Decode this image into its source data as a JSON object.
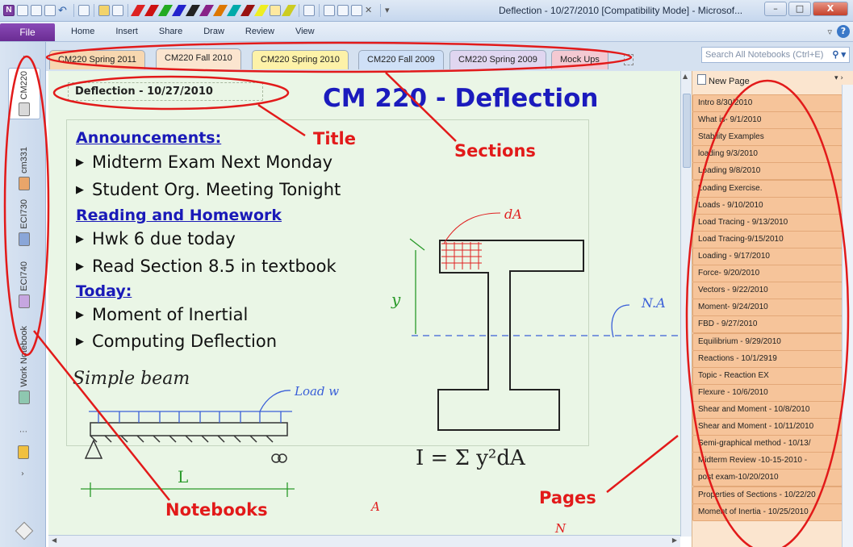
{
  "window": {
    "title": "Deflection - 10/27/2010 [Compatibility Mode] - Microsof...",
    "min": "–",
    "max": "□",
    "close": "X"
  },
  "menu": {
    "file": "File",
    "items": [
      "Home",
      "Insert",
      "Share",
      "Draw",
      "Review",
      "View"
    ]
  },
  "notebooks": [
    {
      "label": "CM220",
      "color": "#d9d9d9",
      "selected": true
    },
    {
      "label": "cm331",
      "color": "#e9a56a"
    },
    {
      "label": "ECI730",
      "color": "#8aa6d8"
    },
    {
      "label": "ECI740",
      "color": "#c6a6e0"
    },
    {
      "label": "Work Notebook",
      "color": "#8ec7b0"
    }
  ],
  "sections": [
    {
      "label": "CM220 Spring 2011",
      "color": "#f7d7b0"
    },
    {
      "label": "CM220 Fall 2010",
      "color": "#fbe5cf",
      "active": true
    },
    {
      "label": "CM220 Spring 2010",
      "color": "#fdf2a8"
    },
    {
      "label": "CM220 Fall 2009",
      "color": "#cfe0f7"
    },
    {
      "label": "CM220 Spring 2009",
      "color": "#e0d6f0"
    },
    {
      "label": "Mock Ups",
      "color": "#f4c9d2"
    }
  ],
  "search": {
    "placeholder": "Search All Notebooks (Ctrl+E)"
  },
  "page": {
    "title": "Deflection - 10/27/2010",
    "heading": "CM 220 - Deflection",
    "notes": [
      {
        "kind": "head",
        "text": "Announcements:"
      },
      {
        "kind": "item",
        "text": "Midterm Exam Next Monday"
      },
      {
        "kind": "item",
        "text": "Student Org. Meeting Tonight"
      },
      {
        "kind": "head",
        "text": "Reading and Homework"
      },
      {
        "kind": "item",
        "text": "Hwk 6 due today"
      },
      {
        "kind": "item",
        "text": "Read Section 8.5 in textbook"
      },
      {
        "kind": "head",
        "text": "Today:"
      },
      {
        "kind": "item",
        "text": "Moment of Inertial"
      },
      {
        "kind": "item",
        "text": "Computing Deflection"
      }
    ],
    "ink": {
      "beam_label": "Simple beam",
      "load_label": "Load w",
      "span_label": "L",
      "area_label": "dA",
      "y_label": "y",
      "na_label": "N.A",
      "formula": "I = Σ y²dA",
      "partial_a": "A",
      "partial_n": "N"
    }
  },
  "pages": {
    "new_page": "New Page",
    "items": [
      "Intro 8/30/2010",
      "What is- 9/1/2010",
      "Stability Examples",
      "loading 9/3/2010",
      "Loading 9/8/2010",
      "Loading Exercise.",
      "Loads - 9/10/2010",
      "Load Tracing - 9/13/2010",
      "Load Tracing-9/15/2010",
      "Loading - 9/17/2010",
      "Force- 9/20/2010",
      "Vectors - 9/22/2010",
      "Moment- 9/24/2010",
      "FBD - 9/27/2010",
      "Equilibrium - 9/29/2010",
      "Reactions - 10/1/2919",
      "Topic - Reaction EX",
      "Flexure - 10/6/2010",
      "Shear and Moment - 10/8/2010",
      "Shear and Moment - 10/11/2010",
      "Semi-graphical method - 10/13/",
      "Midterm Review -10-15-2010 -",
      "post exam-10/20/2010",
      "Properties of Sections - 10/22/20",
      "Moment of Inertia - 10/25/2010"
    ]
  },
  "annotations": {
    "title": "Title",
    "sections": "Sections",
    "notebooks": "Notebooks",
    "pages": "Pages"
  }
}
